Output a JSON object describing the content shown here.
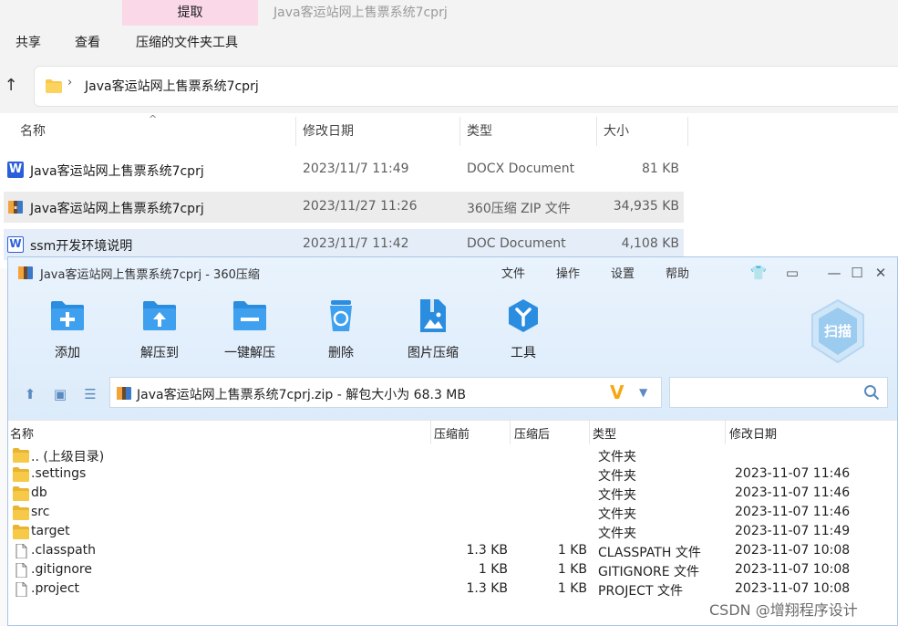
{
  "explorer": {
    "extract_tab": "提取",
    "window_title": "Java客运站网上售票系统7cprj",
    "menu": [
      "共享",
      "查看",
      "压缩的文件夹工具"
    ],
    "address": "Java客运站网上售票系统7cprj",
    "columns": [
      "名称",
      "修改日期",
      "类型",
      "大小"
    ],
    "files": [
      {
        "name": "Java客运站网上售票系统7cprj",
        "date": "2023/11/7 11:49",
        "type": "DOCX Document",
        "size": "81 KB",
        "icon": "word-docx-icon"
      },
      {
        "name": "Java客运站网上售票系统7cprj",
        "date": "2023/11/27 11:26",
        "type": "360压缩 ZIP 文件",
        "size": "34,935 KB",
        "icon": "zip-archive-icon"
      },
      {
        "name": "ssm开发环境说明",
        "date": "2023/11/7 11:42",
        "type": "DOC Document",
        "size": "4,108 KB",
        "icon": "word-doc-icon"
      }
    ]
  },
  "zip": {
    "title": "Java客运站网上售票系统7cprj - 360压缩",
    "menu": [
      "文件",
      "操作",
      "设置",
      "帮助"
    ],
    "tools": [
      "添加",
      "解压到",
      "一键解压",
      "删除",
      "图片压缩",
      "工具"
    ],
    "scan_label": "扫描",
    "path": "Java客运站网上售票系统7cprj.zip - 解包大小为 68.3 MB",
    "columns": [
      "名称",
      "压缩前",
      "压缩后",
      "类型",
      "修改日期"
    ],
    "rows": [
      {
        "name": ".. (上级目录)",
        "before": "",
        "after": "",
        "type": "文件夹",
        "date": "",
        "icon": "folder-icon"
      },
      {
        "name": ".settings",
        "before": "",
        "after": "",
        "type": "文件夹",
        "date": "2023-11-07 11:46",
        "icon": "folder-icon"
      },
      {
        "name": "db",
        "before": "",
        "after": "",
        "type": "文件夹",
        "date": "2023-11-07 11:46",
        "icon": "folder-icon"
      },
      {
        "name": "src",
        "before": "",
        "after": "",
        "type": "文件夹",
        "date": "2023-11-07 11:46",
        "icon": "folder-icon"
      },
      {
        "name": "target",
        "before": "",
        "after": "",
        "type": "文件夹",
        "date": "2023-11-07 11:49",
        "icon": "folder-icon"
      },
      {
        "name": ".classpath",
        "before": "1.3 KB",
        "after": "1 KB",
        "type": "CLASSPATH 文件",
        "date": "2023-11-07 10:08",
        "icon": "file-icon"
      },
      {
        "name": ".gitignore",
        "before": "1 KB",
        "after": "1 KB",
        "type": "GITIGNORE 文件",
        "date": "2023-11-07 10:08",
        "icon": "file-icon"
      },
      {
        "name": ".project",
        "before": "1.3 KB",
        "after": "1 KB",
        "type": "PROJECT 文件",
        "date": "2023-11-07 10:08",
        "icon": "file-icon"
      }
    ]
  },
  "watermark": "CSDN @增翔程序设计",
  "colors": {
    "accent_blue": "#2b8de0",
    "folder_yellow": "#f7c948",
    "selection_gray": "#ececec",
    "zip_header": "#dcebfa"
  }
}
